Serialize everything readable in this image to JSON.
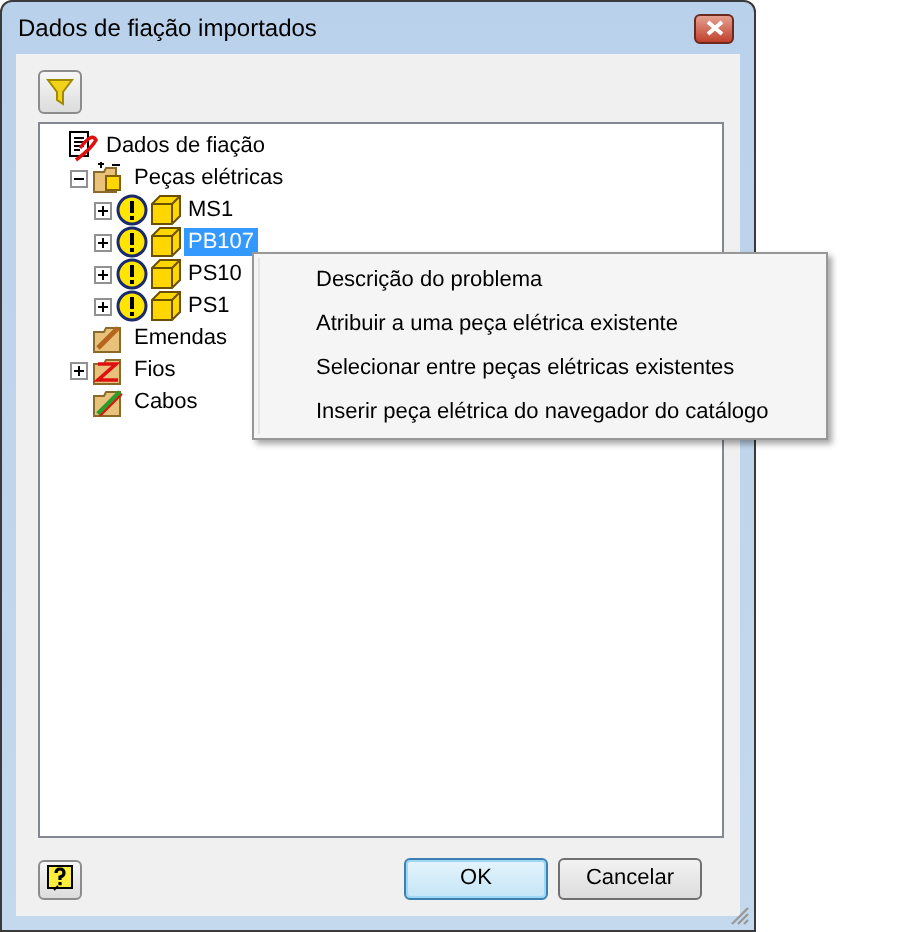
{
  "window": {
    "title": "Dados de fiação importados"
  },
  "tree": [
    {
      "label": "Dados de fiação",
      "kind": "root",
      "selected": false,
      "children": [
        {
          "label": "Peças elétricas",
          "kind": "parts",
          "expanded": true,
          "selected": false,
          "children": [
            {
              "label": "MS1",
              "kind": "part",
              "warning": true,
              "expanded": false,
              "selected": false
            },
            {
              "label": "PB107",
              "kind": "part",
              "warning": true,
              "expanded": false,
              "selected": true
            },
            {
              "label": "PS10",
              "kind": "part",
              "warning": true,
              "expanded": false,
              "selected": false
            },
            {
              "label": "PS1",
              "kind": "part",
              "warning": true,
              "expanded": false,
              "selected": false
            }
          ]
        },
        {
          "label": "Emendas",
          "kind": "splices",
          "selected": false
        },
        {
          "label": "Fios",
          "kind": "wires",
          "expanded": false,
          "selected": false
        },
        {
          "label": "Cabos",
          "kind": "cables",
          "selected": false
        }
      ]
    }
  ],
  "context_menu": [
    "Descrição do problema",
    "Atribuir a uma peça elétrica existente",
    "Selecionar entre peças elétricas existentes",
    "Inserir peça elétrica do navegador do catálogo"
  ],
  "buttons": [
    {
      "label": "OK",
      "default": true
    },
    {
      "label": "Cancelar",
      "default": false
    }
  ]
}
